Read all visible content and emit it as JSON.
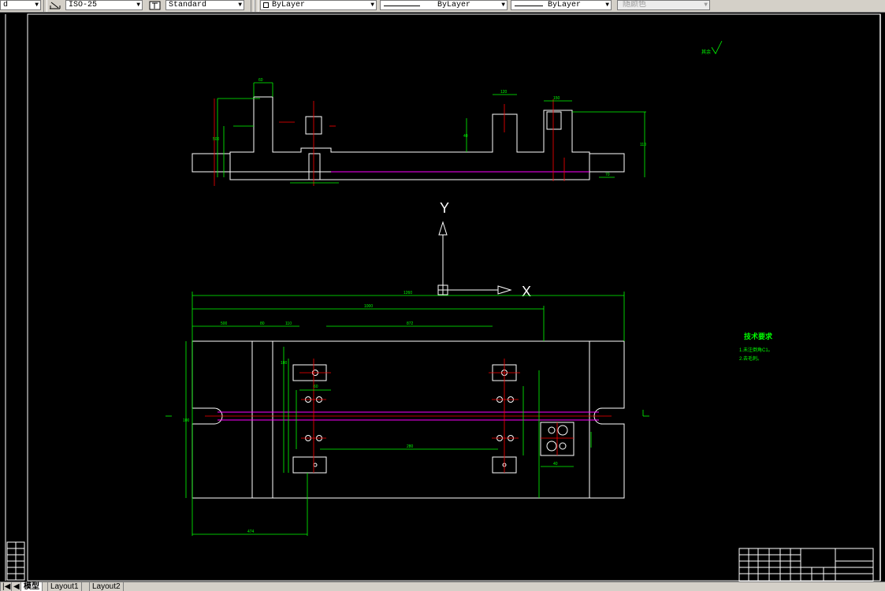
{
  "toolbar": {
    "dimstyle_value": "ISO-25",
    "textstyle_value": "Standard",
    "layer_value": "ByLayer",
    "linetype_value": "ByLayer",
    "lineweight_value": "ByLayer",
    "color_value": "随颜色"
  },
  "drawing": {
    "top_view_dims": [
      "60",
      "120",
      "150",
      "110",
      "500",
      "40",
      "70"
    ],
    "axis": {
      "y_label": "Y",
      "x_label": "X"
    },
    "plan_dims": [
      "1260",
      "1000",
      "500",
      "80",
      "110",
      "872",
      "280",
      "100",
      "60",
      "100",
      "474",
      "40"
    ],
    "roughness_label": "其余",
    "tech_req": {
      "title": "技术要求",
      "item1": "1.未注倒角C1。",
      "item2": "2.去毛刺。"
    }
  },
  "tabs": [
    {
      "label": "模型",
      "active": true
    },
    {
      "label": "Layout1",
      "active": false
    },
    {
      "label": "Layout2",
      "active": false
    }
  ],
  "colors": {
    "background": "#000000",
    "dimension": "#00ff00",
    "object": "#ffffff",
    "center": "#ff0000",
    "hidden": "#ff00ff"
  }
}
